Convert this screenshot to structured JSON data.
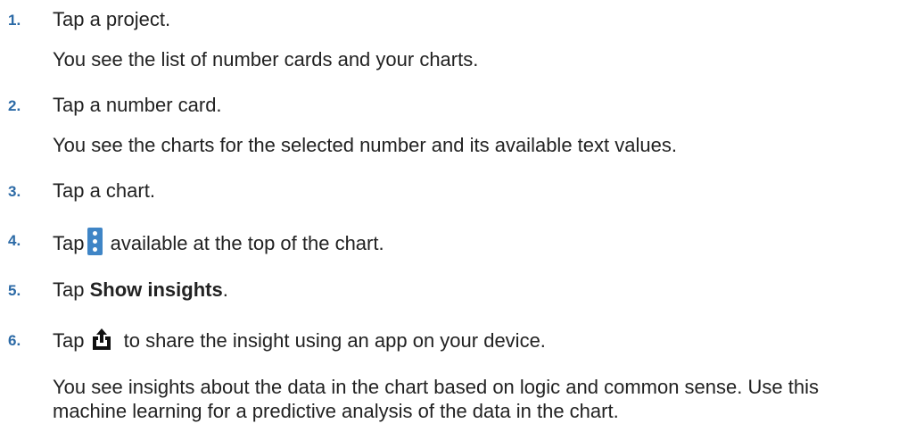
{
  "steps": [
    {
      "number": "1.",
      "text": "Tap a project."
    },
    {
      "number": "2.",
      "text": "Tap a number card."
    },
    {
      "number": "3.",
      "text": "Tap a chart."
    },
    {
      "number": "4.",
      "before": "Tap",
      "after": "available at the top of the chart.",
      "icon": "kebab-menu-icon"
    },
    {
      "number": "5.",
      "before": "Tap ",
      "bold": "Show insights",
      "after": "."
    },
    {
      "number": "6.",
      "before": "Tap",
      "after": "to share the insight using an app on your device.",
      "icon": "share-icon"
    }
  ],
  "notes": {
    "after_step1": "You see the list of number cards and your charts.",
    "after_step2": "You see the charts for the selected number and its available text values.",
    "after_step6": "You see insights about the data in the chart based on logic and common sense. Use this machine learning for a predictive analysis of the data in the chart."
  },
  "colors": {
    "step_number": "#2c6aa6",
    "kebab_bg": "#3f85c6",
    "text": "#222222"
  }
}
